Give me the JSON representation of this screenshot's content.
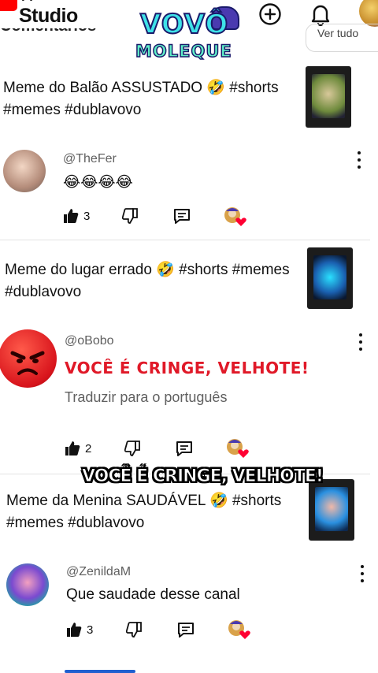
{
  "app": {
    "name": "Studio",
    "name_top": "YT"
  },
  "header": {
    "sort_label": "Ver tudo",
    "partial_heading": "Comentários"
  },
  "overlay": {
    "logo_line1": "VOVÔ",
    "logo_line2": "MOLEQUE",
    "caption": "VOCÊ É CRINGE, VELHOTE!"
  },
  "comments": [
    {
      "video_title": "Meme do Balão ASSUSTADO 🤣 #shorts #memes #dublavovo",
      "handle": "@TheFer",
      "text": "😂😂😂😂",
      "translate": "",
      "likes": "3"
    },
    {
      "video_title": "Meme do lugar errado 🤣 #shorts #memes #dublavovo",
      "handle": "@oBobo",
      "text": "VOCÊ É CRINGE, VELHOTE!",
      "translate": "Traduzir para o português",
      "likes": "2"
    },
    {
      "video_title": "Meme da Menina SAUDÁVEL 🤣 #shorts #memes #dublavovo",
      "handle": "@ZenildaM",
      "text": "Que saudade desse canal",
      "translate": "",
      "likes": "3"
    }
  ],
  "colors": {
    "brand_red": "#ff0000",
    "heart": "#ff0033",
    "text_secondary": "#606060",
    "cringe_red": "#e01928"
  },
  "icons": {
    "create": "plus-circle-icon",
    "notifications": "bell-icon",
    "like": "thumb-up-icon",
    "dislike": "thumb-down-icon",
    "reply": "comment-icon",
    "creator_heart": "creator-heart-icon",
    "more": "more-vertical-icon"
  }
}
